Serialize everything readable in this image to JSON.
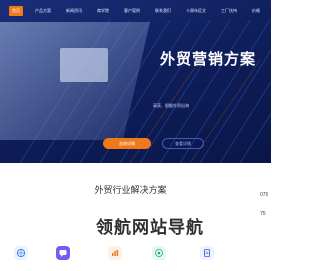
{
  "nav": {
    "items": [
      {
        "label": "首页",
        "active": true
      },
      {
        "label": "产品方案"
      },
      {
        "label": "新闻资讯"
      },
      {
        "label": "商学院"
      },
      {
        "label": "客户案例"
      },
      {
        "label": "联系我们"
      },
      {
        "label": "十周年征文"
      },
      {
        "label": "工厂扶持"
      }
    ],
    "right_label": "价格"
  },
  "hero": {
    "title": "外贸营销方案",
    "subtitle": "高获、赋能外贸出海",
    "primary_button": "咨询详情",
    "secondary_button": "查看详情"
  },
  "section": {
    "title": "外贸行业解决方案",
    "phone_prefix": "075",
    "phone_prefix_2": "75"
  },
  "watermark": "领航网站导航",
  "colors": {
    "accent": "#f07a1a",
    "hero_bg": "#0f1f5c"
  },
  "icons": [
    "globe-icon",
    "chat-icon",
    "chart-icon",
    "target-icon",
    "document-icon"
  ]
}
